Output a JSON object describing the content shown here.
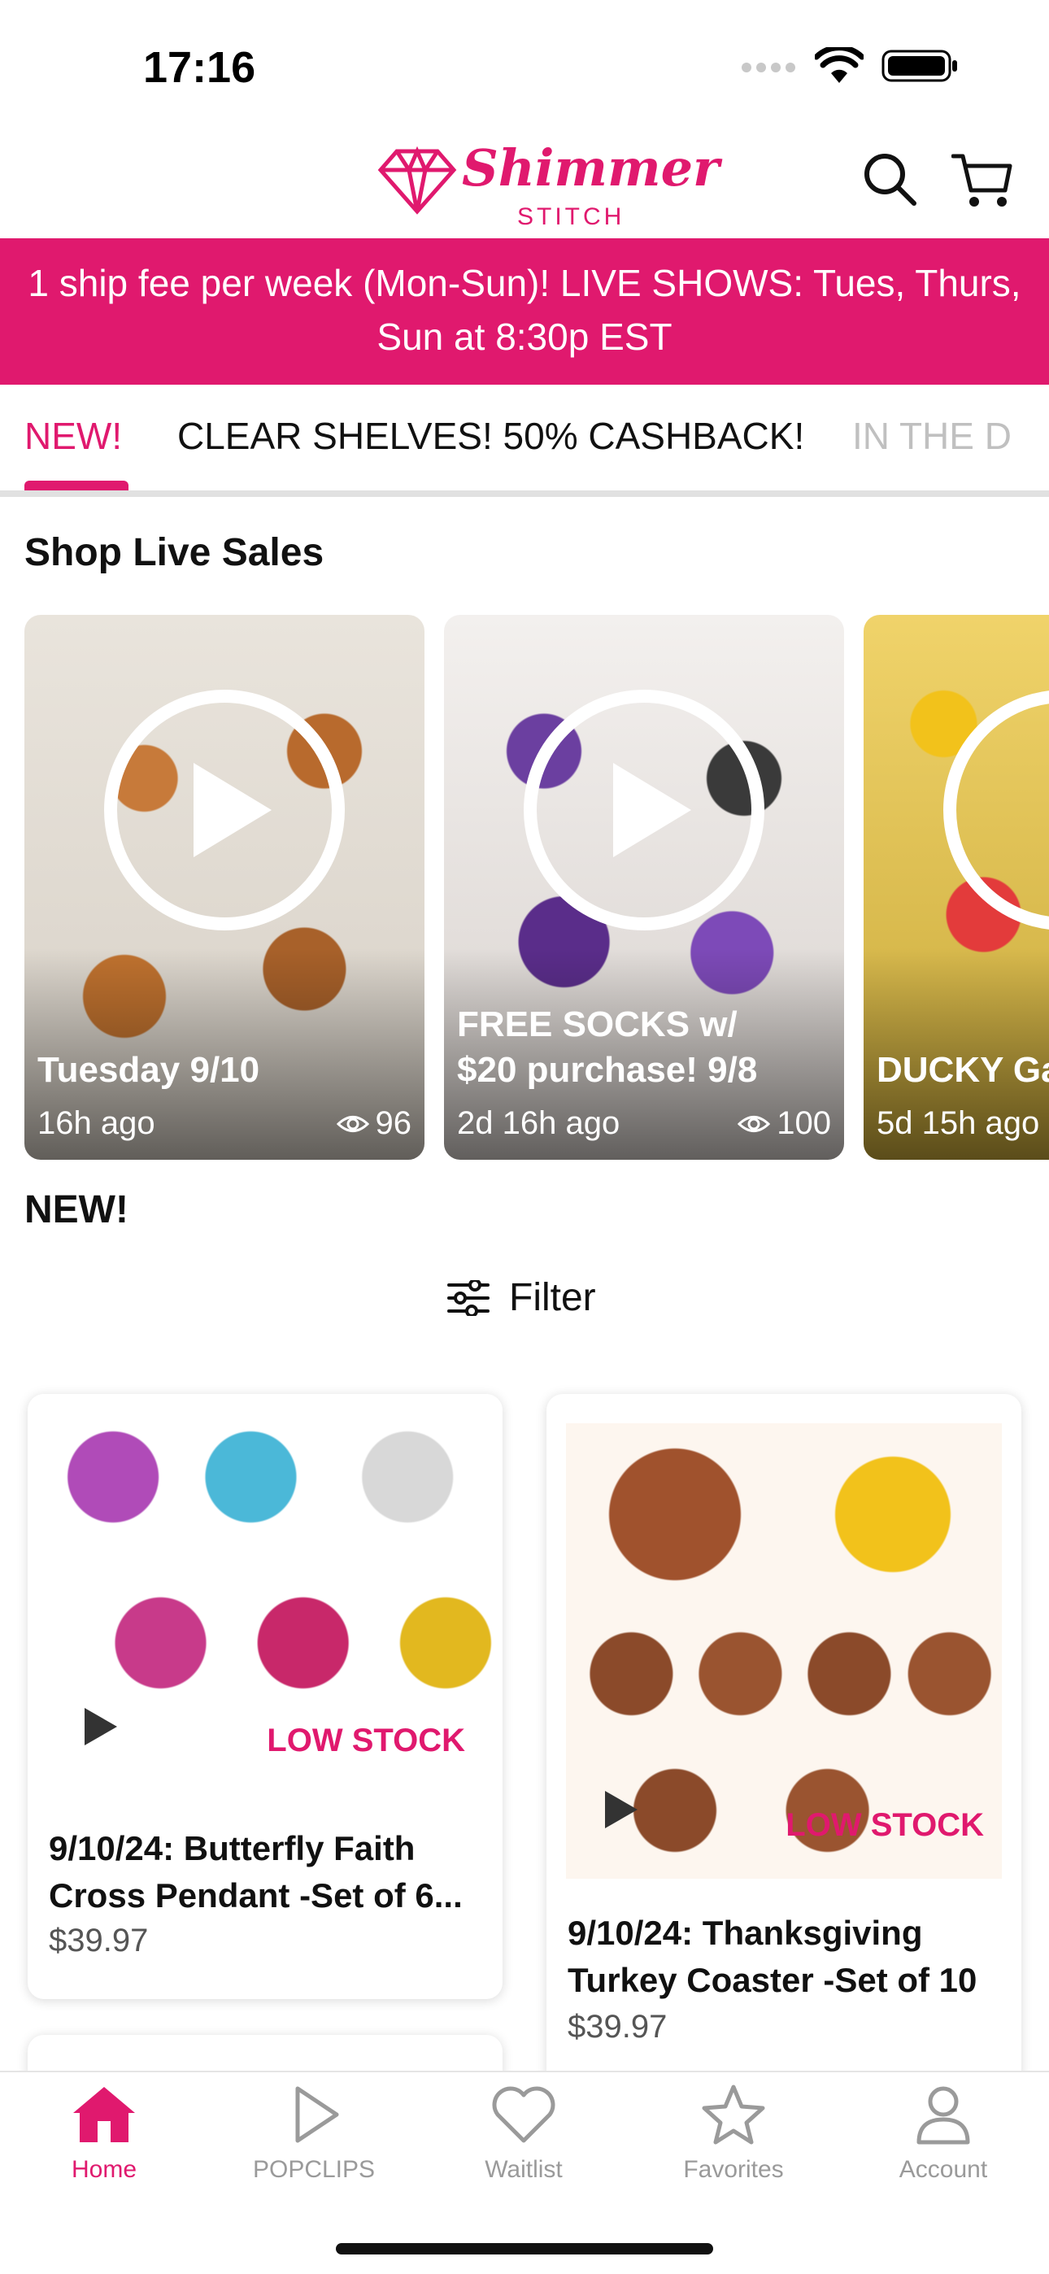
{
  "status_bar": {
    "time": "17:16"
  },
  "brand": {
    "name": "Shimmer",
    "sub": "STITCH",
    "accent": "#e0196e"
  },
  "promo": {
    "text": "1 ship fee per week (Mon-Sun)! LIVE SHOWS: Tues, Thurs, Sun at 8:30p EST"
  },
  "tabs": [
    {
      "label": "NEW!"
    },
    {
      "label": "CLEAR SHELVES! 50% CASHBACK!"
    },
    {
      "label": "IN THE D"
    }
  ],
  "live_section": {
    "title": "Shop Live Sales",
    "cards": [
      {
        "title": "Tuesday 9/10",
        "time": "16h ago",
        "views": "96"
      },
      {
        "title": "FREE SOCKS w/ $20 purchase! 9/8",
        "time": "2d 16h ago",
        "views": "100"
      },
      {
        "title": "DUCKY Ga",
        "time": "5d 15h ago",
        "views": ""
      }
    ]
  },
  "new_section": {
    "title": "NEW!",
    "filter_label": "Filter"
  },
  "products": [
    {
      "badge": "LOW STOCK",
      "title": "9/10/24: Butterfly Faith Cross Pendant -Set of 6...",
      "price": "$39.97"
    },
    {
      "badge": "LOW STOCK",
      "title": "9/10/24: Thanksgiving Turkey Coaster -Set of 10",
      "price": "$39.97"
    }
  ],
  "nav": [
    {
      "label": "Home",
      "icon": "home-icon"
    },
    {
      "label": "POPCLIPS",
      "icon": "play-outline-icon"
    },
    {
      "label": "Waitlist",
      "icon": "heart-icon"
    },
    {
      "label": "Favorites",
      "icon": "star-icon"
    },
    {
      "label": "Account",
      "icon": "person-icon"
    }
  ]
}
